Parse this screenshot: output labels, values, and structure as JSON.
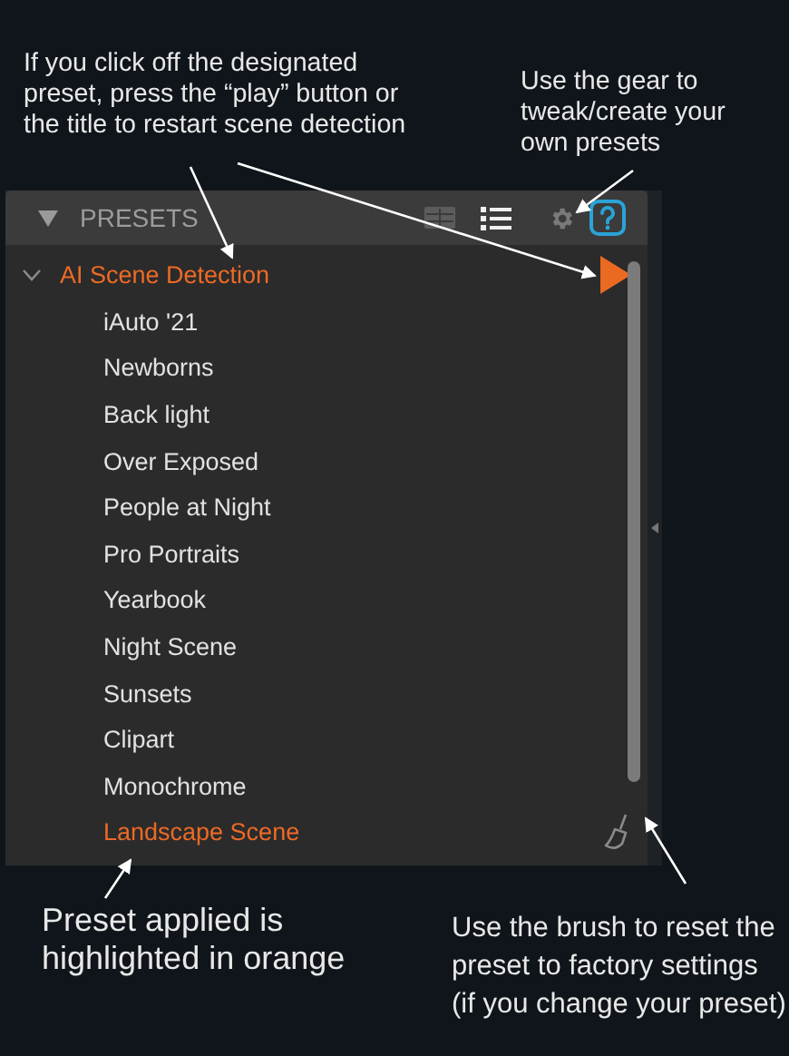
{
  "annotations_top": [
    "If you click off the designated preset, press the “play” button or the title to restart scene detection",
    "Use the gear to tweak/create your own presets"
  ],
  "panel": {
    "title": "PRESETS",
    "expanded": true,
    "groups": [
      {
        "label": "AI Scene Detection",
        "expanded": true,
        "selected": true,
        "children": [
          {
            "label": "iAuto '21",
            "selected": false
          },
          {
            "label": "Newborns",
            "selected": false
          },
          {
            "label": "Back light",
            "selected": false
          },
          {
            "label": "Over Exposed",
            "selected": false
          },
          {
            "label": "People at Night",
            "selected": false
          },
          {
            "label": "Pro Portraits",
            "selected": false
          },
          {
            "label": "Yearbook",
            "selected": false
          },
          {
            "label": "Night Scene",
            "selected": false
          },
          {
            "label": "Sunsets",
            "selected": false
          },
          {
            "label": "Clipart",
            "selected": false
          },
          {
            "label": "Monochrome",
            "selected": false
          },
          {
            "label": "Landscape Scene",
            "selected": true
          }
        ]
      }
    ]
  },
  "annotations_bottom": [
    "Preset applied is highlighted in orange",
    "Use the brush to reset the preset to factory settings (if you change your preset)"
  ]
}
